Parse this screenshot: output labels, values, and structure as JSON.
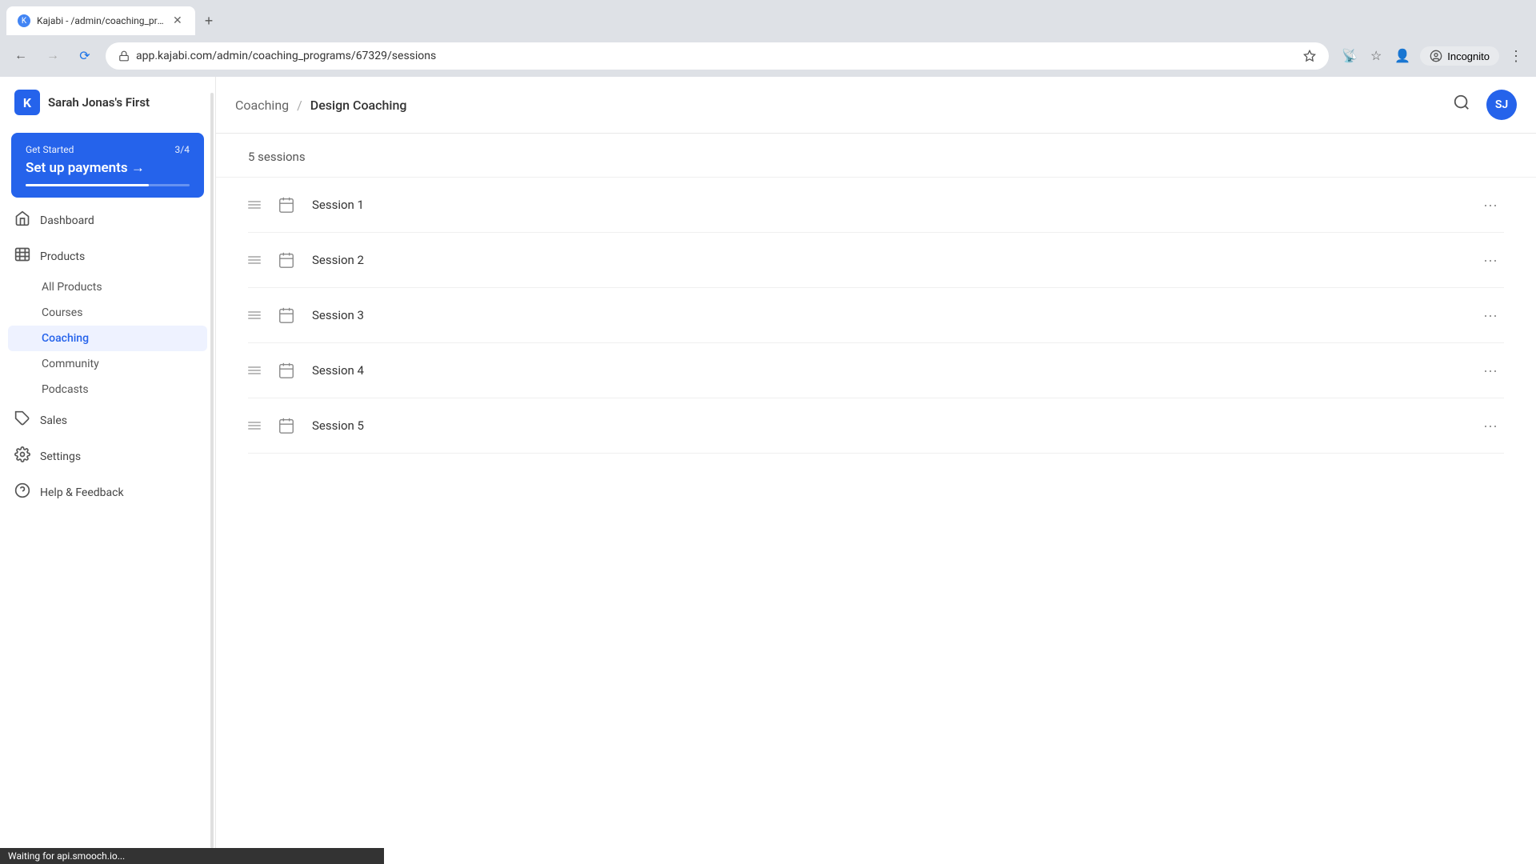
{
  "browser": {
    "tab_title": "Kajabi - /admin/coaching_progra...",
    "tab_icon": "K",
    "url": "app.kajabi.com/admin/coaching_programs/67329/sessions",
    "loading": true,
    "incognito_label": "Incognito"
  },
  "sidebar": {
    "logo_text": "Sarah Jonas's First",
    "logo_icon": "K",
    "get_started": {
      "label": "Get Started",
      "count": "3/4",
      "action": "Set up payments →"
    },
    "nav_items": [
      {
        "id": "dashboard",
        "label": "Dashboard",
        "icon": "🏠"
      },
      {
        "id": "products",
        "label": "Products",
        "icon": "📦"
      }
    ],
    "sub_nav_items": [
      {
        "id": "all-products",
        "label": "All Products"
      },
      {
        "id": "courses",
        "label": "Courses"
      },
      {
        "id": "coaching",
        "label": "Coaching",
        "active": true
      },
      {
        "id": "community",
        "label": "Community"
      },
      {
        "id": "podcasts",
        "label": "Podcasts"
      }
    ],
    "bottom_nav": [
      {
        "id": "sales",
        "label": "Sales",
        "icon": "🏷"
      },
      {
        "id": "settings",
        "label": "Settings",
        "icon": "⚙️"
      },
      {
        "id": "help",
        "label": "Help & Feedback",
        "icon": "❓"
      }
    ]
  },
  "header": {
    "breadcrumb_parent": "Coaching",
    "breadcrumb_separator": "/",
    "breadcrumb_current": "Design Coaching",
    "avatar_initials": "SJ"
  },
  "sessions": {
    "count_label": "5 sessions",
    "items": [
      {
        "id": 1,
        "name": "Session 1"
      },
      {
        "id": 2,
        "name": "Session 2"
      },
      {
        "id": 3,
        "name": "Session 3"
      },
      {
        "id": 4,
        "name": "Session 4"
      },
      {
        "id": 5,
        "name": "Session 5"
      }
    ]
  },
  "status_bar": {
    "text": "Waiting for api.smooch.io..."
  }
}
